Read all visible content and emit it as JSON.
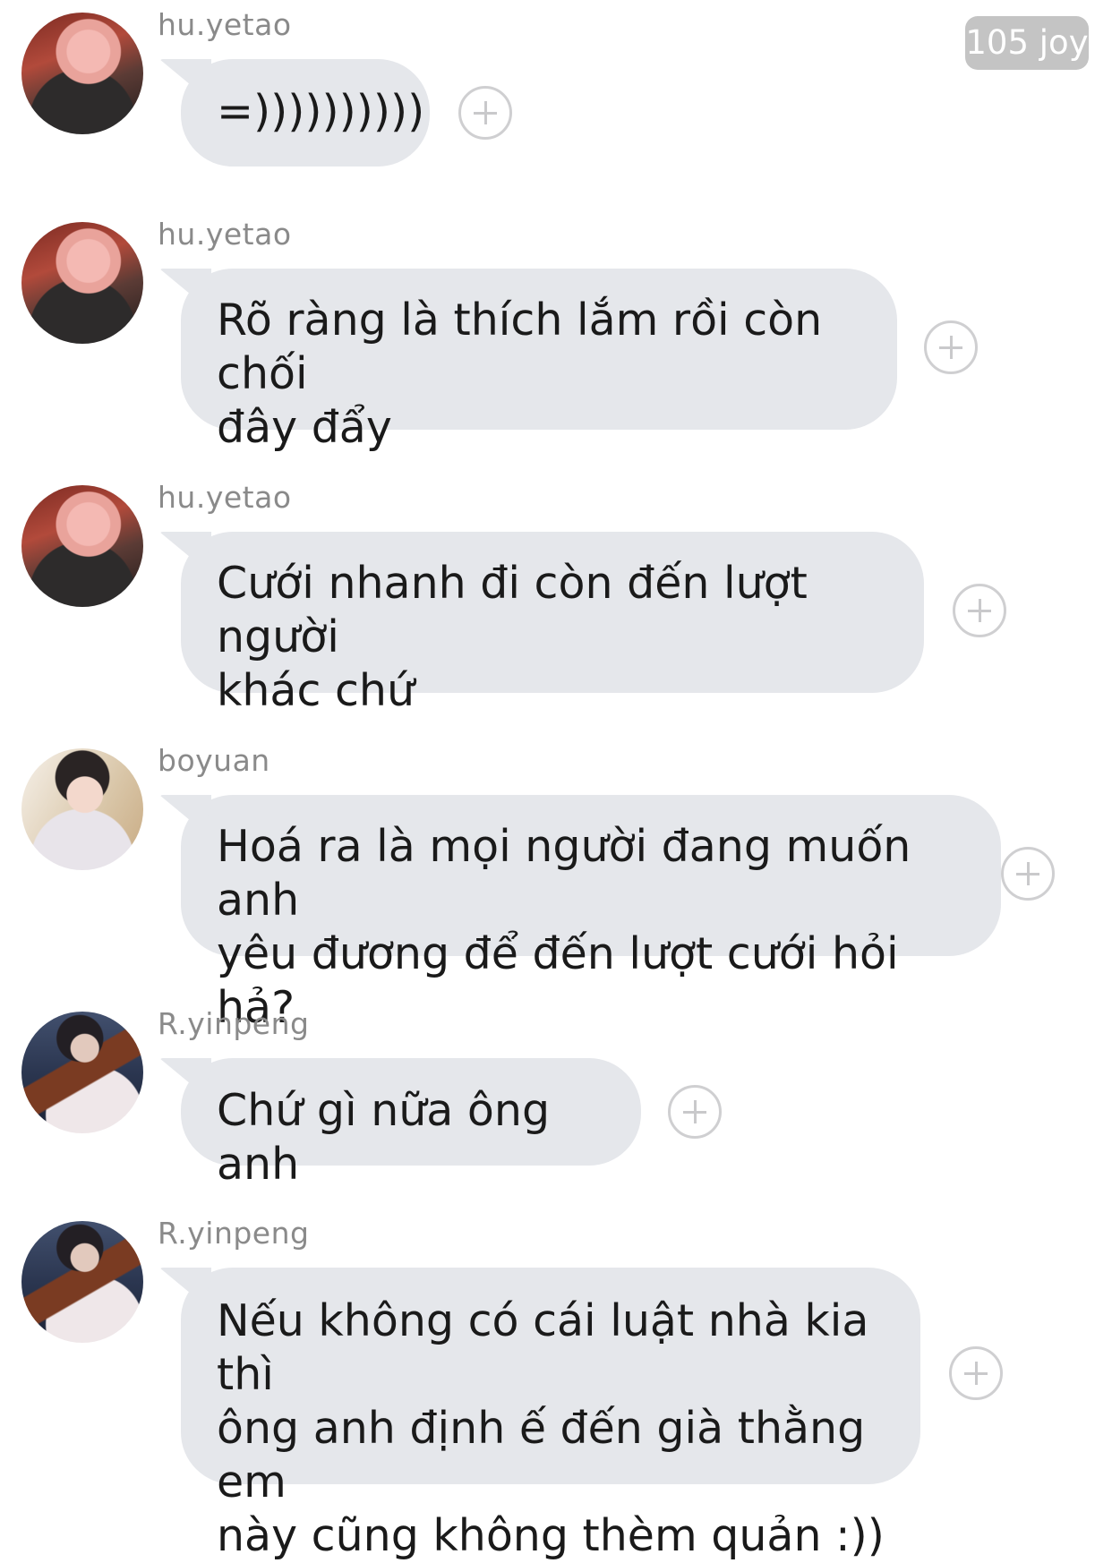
{
  "badge": {
    "label": "105 joy"
  },
  "messages": [
    {
      "user": "hu.yetao",
      "text": "=))))))))))"
    },
    {
      "user": "hu.yetao",
      "text": "Rõ ràng là thích lắm rồi còn chối\nđây đẩy"
    },
    {
      "user": "hu.yetao",
      "text": "Cưới nhanh đi còn đến lượt người\nkhác chứ"
    },
    {
      "user": "boyuan",
      "text": "Hoá ra là mọi người đang muốn anh\nyêu đương để đến lượt cưới hỏi hả?"
    },
    {
      "user": "R.yinpeng",
      "text": "Chứ gì nữa ông anh"
    },
    {
      "user": "R.yinpeng",
      "text": "Nếu không có cái luật nhà kia thì\nông anh định ế đến già thằng em\nnày cũng không thèm quản :))"
    }
  ]
}
